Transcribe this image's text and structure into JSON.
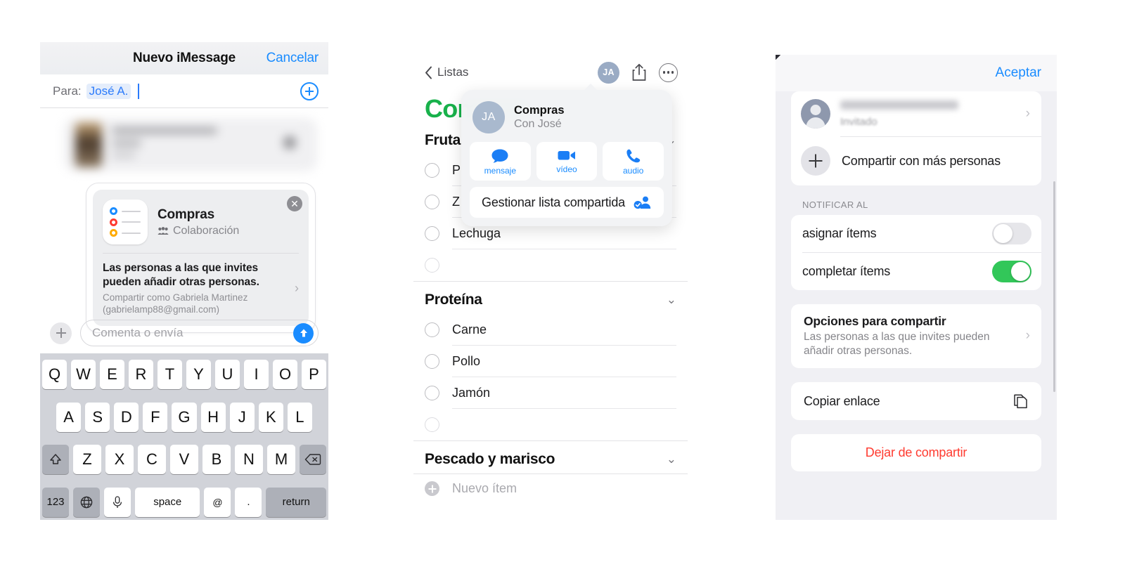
{
  "panel1": {
    "navbar": {
      "title": "Nuevo iMessage",
      "cancel": "Cancelar"
    },
    "to_row": {
      "label": "Para:",
      "recipient": "José  A.",
      "add_icon": "plus-circle-icon"
    },
    "attachment_card": {
      "app_icon": "reminders-list-icon",
      "icon_dot_colors": [
        "#1a8cff",
        "#ff3b30",
        "#ffab00"
      ],
      "title": "Compras",
      "subtitle": "Colaboración",
      "subtitle_icon": "collaboration-people-icon",
      "body_bold": "Las personas a las que invites pueden añadir otras personas.",
      "body_small": "Compartir como Gabriela Martinez (gabrielamp88@gmail.com)",
      "chevron": "›",
      "close_icon": "close-circle-icon"
    },
    "input_bar": {
      "add_icon": "plus-icon",
      "placeholder": "Comenta o envía",
      "send_icon": "send-arrow-up-icon"
    },
    "keyboard": {
      "row1": [
        "Q",
        "W",
        "E",
        "R",
        "T",
        "Y",
        "U",
        "I",
        "O",
        "P"
      ],
      "row2": [
        "A",
        "S",
        "D",
        "F",
        "G",
        "H",
        "J",
        "K",
        "L"
      ],
      "row3": [
        "Z",
        "X",
        "C",
        "V",
        "B",
        "N",
        "M"
      ],
      "shift_icon": "shift-up-arrow-icon",
      "backspace_icon": "backspace-delete-icon",
      "numbers": "123",
      "globe_icon": "globe-language-icon",
      "mic_icon": "microphone-icon",
      "space": "space",
      "at": "@",
      "period": ".",
      "return": "return"
    }
  },
  "panel2": {
    "navbar": {
      "back_icon": "chevron-left-icon",
      "back_label": "Listas",
      "avatar_initials": "JA",
      "share_icon": "share-up-box-icon",
      "more_icon": "ellipsis-circle-icon"
    },
    "list_title": "Compras",
    "list_title_color": "#18b14b",
    "sections": [
      {
        "name": "Fruta",
        "chevron_icon": "chevron-down-icon",
        "items": [
          "P",
          "Z",
          "Lechuga",
          ""
        ]
      },
      {
        "name": "Proteína",
        "chevron_icon": "chevron-down-icon",
        "items": [
          "Carne",
          "Pollo",
          "Jamón",
          ""
        ]
      },
      {
        "name": "Pescado y marisco",
        "chevron_icon": "chevron-down-icon",
        "items": []
      }
    ],
    "new_item": {
      "icon": "plus-circle-filled-icon",
      "placeholder": "Nuevo ítem"
    },
    "popover": {
      "avatar_initials": "JA",
      "name": "Compras",
      "with": "Con José",
      "actions": [
        {
          "label": "mensaje",
          "icon": "message-bubble-icon"
        },
        {
          "label": "vídeo",
          "icon": "video-camera-icon"
        },
        {
          "label": "audio",
          "icon": "phone-handset-icon"
        }
      ],
      "manage_label": "Gestionar lista compartida",
      "manage_icon": "manage-shared-people-icon"
    }
  },
  "panel3": {
    "navbar": {
      "accept": "Aceptar"
    },
    "contact": {
      "name_redacted": "",
      "status": "Invitado",
      "chevron": "›",
      "avatar_icon": "person-placeholder-icon"
    },
    "share_more": {
      "label": "Compartir con más personas",
      "icon": "plus-icon"
    },
    "notify_caption": "NOTIFICAR AL",
    "toggles": [
      {
        "label": "asignar ítems",
        "on": false
      },
      {
        "label": "completar ítems",
        "on": true
      }
    ],
    "options": {
      "title": "Opciones para compartir",
      "subtitle": "Las personas a las que invites pueden añadir otras personas.",
      "chevron": "›"
    },
    "copy_link": {
      "label": "Copiar enlace",
      "icon": "copy-documents-icon"
    },
    "stop_sharing": {
      "label": "Dejar de compartir",
      "color": "#ff3b30"
    }
  }
}
